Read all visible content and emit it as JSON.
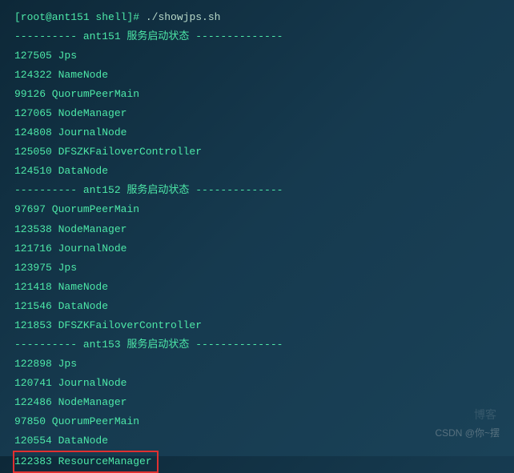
{
  "prompt": {
    "user_host": "[root@ant151 shell]#",
    "command": "./showjps.sh"
  },
  "sections": [
    {
      "header": "---------- ant151 服务启动状态 --------------",
      "lines": [
        "127505 Jps",
        "124322 NameNode",
        "99126 QuorumPeerMain",
        "127065 NodeManager",
        "124808 JournalNode",
        "125050 DFSZKFailoverController",
        "124510 DataNode"
      ]
    },
    {
      "header": "---------- ant152 服务启动状态 --------------",
      "lines": [
        "97697 QuorumPeerMain",
        "123538 NodeManager",
        "121716 JournalNode",
        "123975 Jps",
        "121418 NameNode",
        "121546 DataNode",
        "121853 DFSZKFailoverController"
      ]
    },
    {
      "header": "---------- ant153 服务启动状态 --------------",
      "lines": [
        "122898 Jps",
        "120741 JournalNode",
        "122486 NodeManager",
        "97850 QuorumPeerMain",
        "120554 DataNode"
      ],
      "highlighted": "122383 ResourceManager"
    }
  ],
  "watermark": "CSDN @你~摆",
  "watermark2": "博客"
}
